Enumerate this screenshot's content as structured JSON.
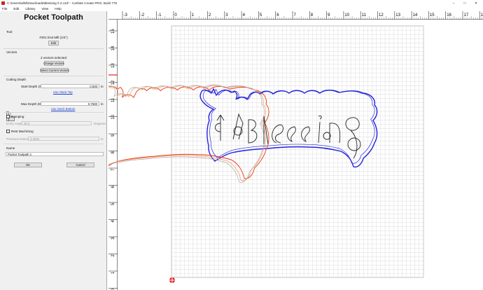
{
  "window": {
    "title": "C:\\Users\\willd\\Downloads\\Blessing #.2.c2d* - Carbide Create PRO, Build 778",
    "min_glyph": "–",
    "max_glyph": "□",
    "close_glyph": "✕"
  },
  "menu": [
    "File",
    "Edit",
    "Library",
    "View",
    "Help"
  ],
  "panel": {
    "title": "Pocket Toolpath",
    "tool_section": "Tool",
    "tool_name": "#201 End Mill (1/4\")",
    "tool_button": "Edit",
    "vectors_section": "Vectors",
    "vectors_selected": "2 vectors selected",
    "change_vectors": "Change Vectors",
    "select_current_vectors": "Select Current Vectors",
    "cutting_depth_section": "Cutting Depth",
    "start_depth_label": "Start Depth (S)",
    "start_depth_value": "0.000",
    "start_depth_unit": "in",
    "use_stock_top": "Use Stock Top",
    "max_depth_label": "Max Depth (D)",
    "max_depth_value": "0.7500",
    "max_depth_unit": "in",
    "use_stock_bottom": "Use Stock Bottom",
    "ramping_label": "Ramping",
    "entry_angle_label": "Entry Angle",
    "entry_angle_value": "30.0",
    "entry_angle_unit": "Degrees",
    "rest_machining_label": "Rest Machining",
    "previous_diameter_label": "Previous Diameter",
    "previous_diameter_value": "0.2500",
    "previous_diameter_unit": "in",
    "name_section": "Name",
    "name_value": "Pocket Toolpath 1",
    "ok_button": "OK",
    "cancel_button": "Cancel"
  },
  "ruler": {
    "x_labels": [
      "-3",
      "-2",
      "-1",
      "0",
      "1",
      "2",
      "3",
      "4",
      "5",
      "6",
      "7",
      "8",
      "9",
      "10",
      "11",
      "12",
      "13",
      "14",
      "15",
      "16",
      "17",
      "18"
    ],
    "y_labels": [
      "15",
      "14",
      "13",
      "12",
      "11",
      "10",
      "9",
      "8",
      "7",
      "6",
      "5",
      "4",
      "3",
      "2",
      "1",
      "0"
    ]
  },
  "colors": {
    "inner_toolpath": "#2222dd",
    "outer_toolpath": "#ee4422",
    "vector": "#222222",
    "ruler_marker": "#e02020"
  }
}
